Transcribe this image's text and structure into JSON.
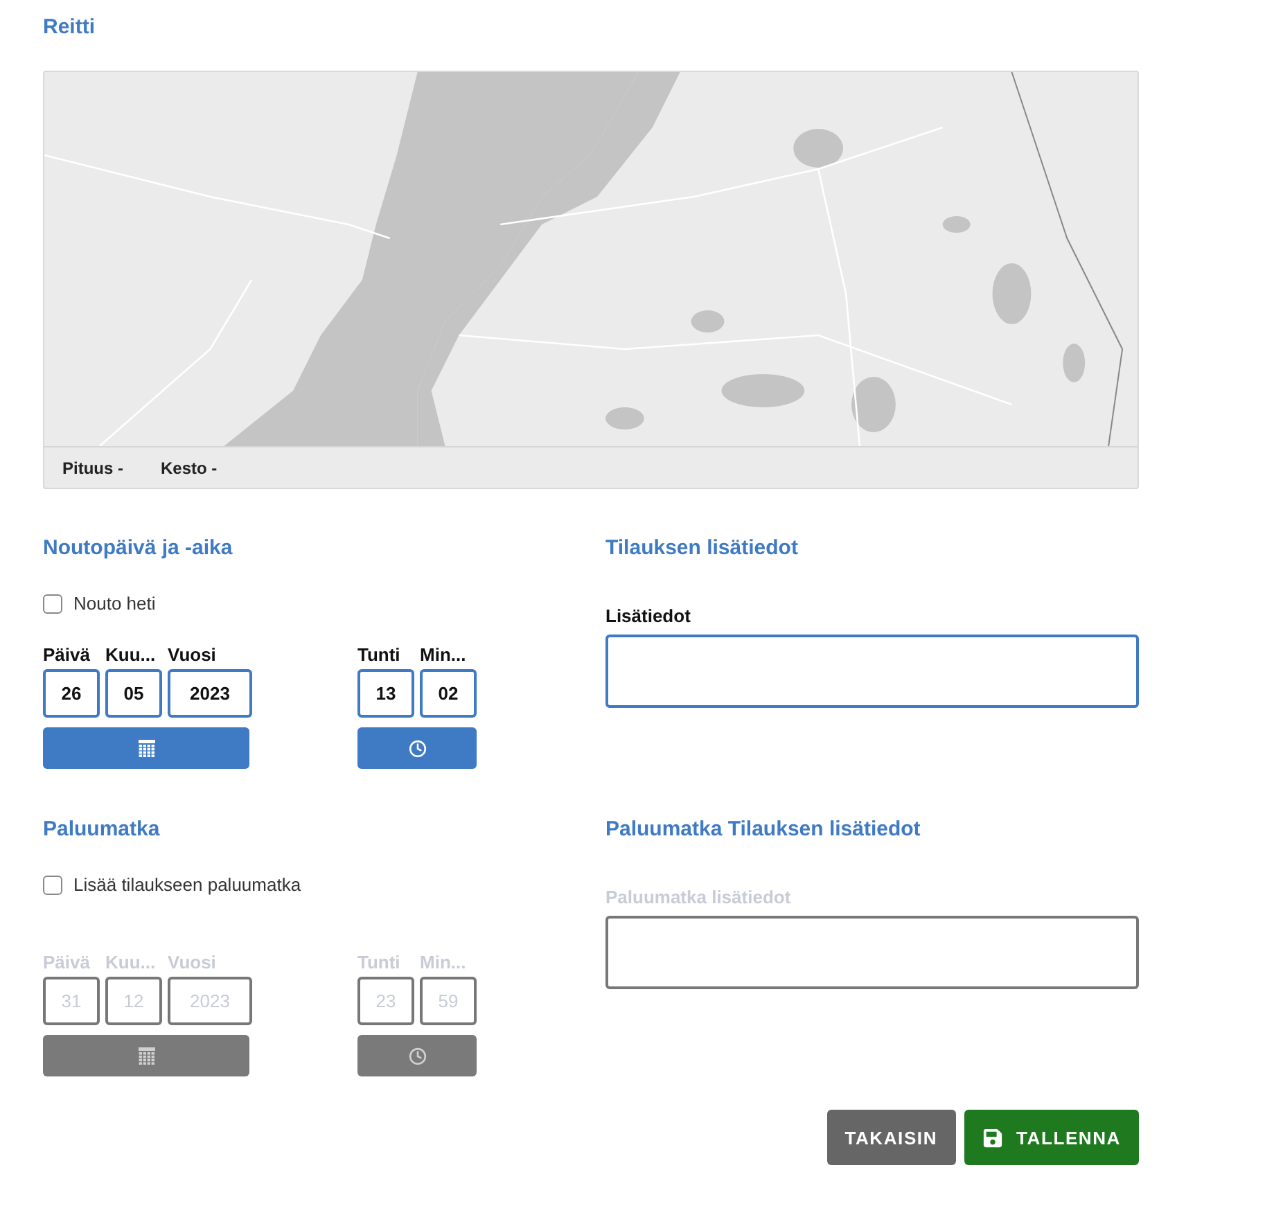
{
  "route": {
    "title": "Reitti",
    "summary": [
      {
        "label": "Pituus -"
      },
      {
        "label": "Kesto -"
      }
    ]
  },
  "pickup": {
    "title": "Noutopäivä ja -aika",
    "disabled": false,
    "checkbox": {
      "label": "Nouto heti",
      "checked": false
    },
    "date_fields": [
      {
        "label": "Päivä",
        "value": "26"
      },
      {
        "label": "Kuu...",
        "value": "05"
      },
      {
        "label": "Vuosi",
        "value": "2023"
      }
    ],
    "time_fields": [
      {
        "label": "Tunti",
        "value": "13"
      },
      {
        "label": "Min...",
        "value": "02"
      }
    ]
  },
  "order_info": {
    "title": "Tilauksen lisätiedot",
    "field_label": "Lisätiedot",
    "disabled": false
  },
  "return_trip": {
    "title": "Paluumatka",
    "disabled": true,
    "checkbox": {
      "label": "Lisää tilaukseen paluumatka",
      "checked": false
    },
    "date_fields": [
      {
        "label": "Päivä",
        "value": "31"
      },
      {
        "label": "Kuu...",
        "value": "12"
      },
      {
        "label": "Vuosi",
        "value": "2023"
      }
    ],
    "time_fields": [
      {
        "label": "Tunti",
        "value": "23"
      },
      {
        "label": "Min...",
        "value": "59"
      }
    ]
  },
  "return_info": {
    "title": "Paluumatka Tilauksen lisätiedot",
    "field_label": "Paluumatka lisätiedot",
    "disabled": true
  },
  "buttons": [
    {
      "label": "TAKAISIN",
      "kind": "back"
    },
    {
      "label": "TALLENNA",
      "kind": "save"
    }
  ]
}
